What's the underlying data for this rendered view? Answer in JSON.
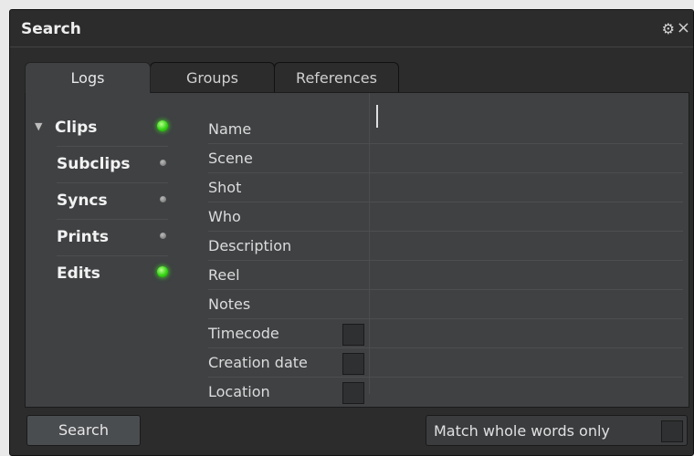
{
  "window": {
    "title": "Search"
  },
  "tabs": [
    {
      "label": "Logs",
      "active": true
    },
    {
      "label": "Groups",
      "active": false
    },
    {
      "label": "References",
      "active": false
    }
  ],
  "logs": [
    {
      "label": "Clips",
      "expanded": true,
      "enabled": true
    },
    {
      "label": "Subclips",
      "enabled": false
    },
    {
      "label": "Syncs",
      "enabled": false
    },
    {
      "label": "Prints",
      "enabled": false
    },
    {
      "label": "Edits",
      "enabled": true
    }
  ],
  "fields": [
    {
      "label": "Name",
      "value": ""
    },
    {
      "label": "Scene",
      "value": ""
    },
    {
      "label": "Shot",
      "value": ""
    },
    {
      "label": "Who",
      "value": ""
    },
    {
      "label": "Description",
      "value": ""
    },
    {
      "label": "Reel",
      "value": ""
    },
    {
      "label": "Notes",
      "value": ""
    },
    {
      "label": "Timecode",
      "value": "",
      "checkbox": false
    },
    {
      "label": "Creation date",
      "value": "",
      "checkbox": false
    },
    {
      "label": "Location",
      "value": "",
      "checkbox": false
    }
  ],
  "footer": {
    "search_label": "Search",
    "match_label": "Match whole words only",
    "match_checked": false
  },
  "icons": {
    "expand": "triangle-down",
    "settings": "gears",
    "close": "x",
    "status_on": "green-led",
    "status_off": "gray-led"
  },
  "colors": {
    "status_on": "#34d414",
    "status_off": "#777777",
    "panel": "#3f4143",
    "window": "#2c2c2c"
  }
}
